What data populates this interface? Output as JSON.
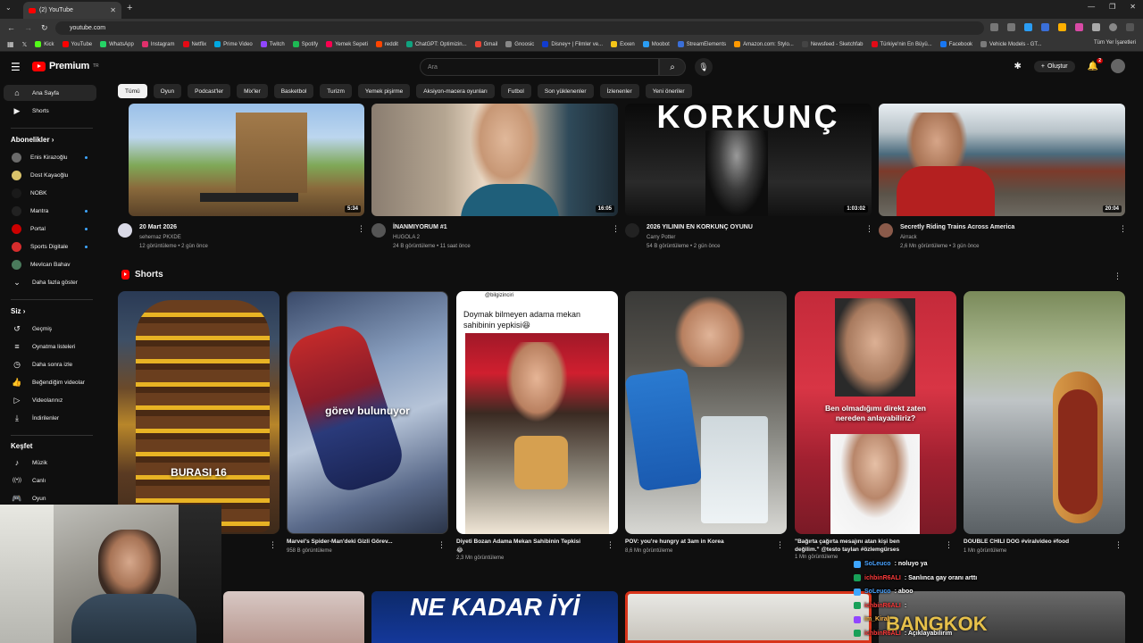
{
  "browser": {
    "tab_title": "(2) YouTube",
    "url": "youtube.com",
    "bookmarks": [
      "Kick",
      "YouTube",
      "WhatsApp",
      "Instagram",
      "Netflix",
      "Prime Video",
      "Twitch",
      "Spotify",
      "Yemek Sepeti",
      "reddit",
      "ChatGPT: Optimizin...",
      "Gmail",
      "Gnoosic",
      "Disney+ | Filmler ve...",
      "Exxen",
      "Moobot",
      "StreamElements",
      "Amazon.com: Stylo...",
      "Newsfeed - Sketchfab",
      "Türkiye'nin En Büyü...",
      "Facebook",
      "Vehicle Models - GT..."
    ],
    "bookmarks_right": "Tüm Yer İşaretleri"
  },
  "masthead": {
    "logo": "Premium",
    "logo_sup": "TR",
    "search_placeholder": "Ara",
    "create_label": "Oluştur",
    "notif_count": "2"
  },
  "sidebar": {
    "top": [
      {
        "label": "Ana Sayfa",
        "icon": "home-icon"
      },
      {
        "label": "Shorts",
        "icon": "shorts-icon"
      }
    ],
    "subs_title": "Abonelikler",
    "subs": [
      {
        "label": "Enis Kirazoğlu",
        "color": "#6b6b6b",
        "live": true
      },
      {
        "label": "Dost Kayaoğlu",
        "color": "#d8c26a",
        "live": false
      },
      {
        "label": "NOBK",
        "color": "#1a1a1a",
        "live": false
      },
      {
        "label": "Mantra",
        "color": "#222222",
        "live": true
      },
      {
        "label": "Portal",
        "color": "#cc0000",
        "live": true
      },
      {
        "label": "Sports Digitale",
        "color": "#d62d2d",
        "live": true
      },
      {
        "label": "Mevlcan Bahav",
        "color": "#4a7a5c",
        "live": false
      }
    ],
    "show_more": "Daha fazla göster",
    "you_title": "Siz",
    "you": [
      {
        "label": "Geçmiş",
        "icon": "history-icon"
      },
      {
        "label": "Oynatma listeleri",
        "icon": "playlists-icon"
      },
      {
        "label": "Daha sonra izle",
        "icon": "watch-later-icon"
      },
      {
        "label": "Beğendiğim videolar",
        "icon": "like-icon"
      },
      {
        "label": "Videolarınız",
        "icon": "your-videos-icon"
      },
      {
        "label": "İndirilenler",
        "icon": "download-icon"
      }
    ],
    "explore_title": "Keşfet",
    "explore": [
      {
        "label": "Müzik",
        "icon": "music-icon"
      },
      {
        "label": "Canlı",
        "icon": "live-icon"
      },
      {
        "label": "Oyun",
        "icon": "gaming-icon"
      }
    ]
  },
  "chips": [
    "Tümü",
    "Oyun",
    "Podcast'ler",
    "Mix'ler",
    "Basketbol",
    "Turizm",
    "Yemek pişirme",
    "Aksiyon-macera oyunları",
    "Futbol",
    "Son yüklenenler",
    "İzlenenler",
    "Yeni öneriler"
  ],
  "videos": [
    {
      "title": "20 Mart 2026",
      "channel": "sehernaz PKXDE",
      "stats": "12 görüntüleme • 2 gün önce",
      "duration": "5:34"
    },
    {
      "title": "İNANMIYORUM #1",
      "channel": "HUGOLA 2",
      "stats": "24 B görüntüleme • 11 saat önce",
      "duration": "16:05"
    },
    {
      "title": "2026 YILININ EN KORKUNÇ OYUNU",
      "channel": "Carry Potter",
      "stats": "54 B görüntüleme • 2 gün önce",
      "duration": "1:03:02"
    },
    {
      "title": "Secretly Riding Trains Across America",
      "channel": "Airrack",
      "stats": "2,6 Mn görüntüleme • 3 gün önce",
      "duration": "20:04"
    }
  ],
  "shorts_title": "Shorts",
  "shorts": [
    {
      "caption": "BURASI 16",
      "title": "",
      "title2": "",
      "views": ""
    },
    {
      "caption": "görev bulunuyor",
      "title": "Marvel's Spider-Man'deki Gizli Görev...",
      "title2": "",
      "views": "958 B görüntüleme"
    },
    {
      "caption": "Doymak bilmeyen adama mekan sahibinin yepkisi😆",
      "handle": "@bilgizinciri",
      "title": "Diyeti Bozan Adama Mekan Sahibinin Tepkisi",
      "title2": "😂",
      "views": "2,3 Mn görüntüleme"
    },
    {
      "caption": "",
      "title": "POV: you're hungry at 3am in Korea",
      "title2": "",
      "views": "8,6 Mn görüntüleme"
    },
    {
      "caption": "Ben olmadığımı direkt zaten nereden anlayabiliriz?",
      "title": "\"Bağırta çağırta mesajını atan kişi ben",
      "title2": "değilim.\" @testo taylan #özlemgürses",
      "views": "1 Mn görüntüleme"
    },
    {
      "caption": "",
      "title": "DOUBLE CHILI DOG #viralvideo #food",
      "title2": "",
      "views": "1 Mn görüntüleme"
    }
  ],
  "bottom_thumb_text": "NE KADAR İYİ",
  "chat": [
    {
      "user": "SoLeuco",
      "msg": ": noluyo ya",
      "color": "#4aa3ff"
    },
    {
      "user": "ichbinR6ALI",
      "msg": ": Sanlınca gay oranı arttı",
      "color": "#ff3b3b"
    },
    {
      "user": "SoLeuco",
      "msg": ": aboo",
      "color": "#4aa3ff"
    },
    {
      "user": "ichbinR6ALI",
      "msg": ":",
      "color": "#ff3b3b"
    },
    {
      "user": "im_Kiral",
      "msg": "",
      "color": "#ffb84a"
    },
    {
      "user": "ichbinR6ALI",
      "msg": ": Açıklayabilirim",
      "color": "#ff3b3b"
    }
  ],
  "overlay_text": "BANGKOK"
}
